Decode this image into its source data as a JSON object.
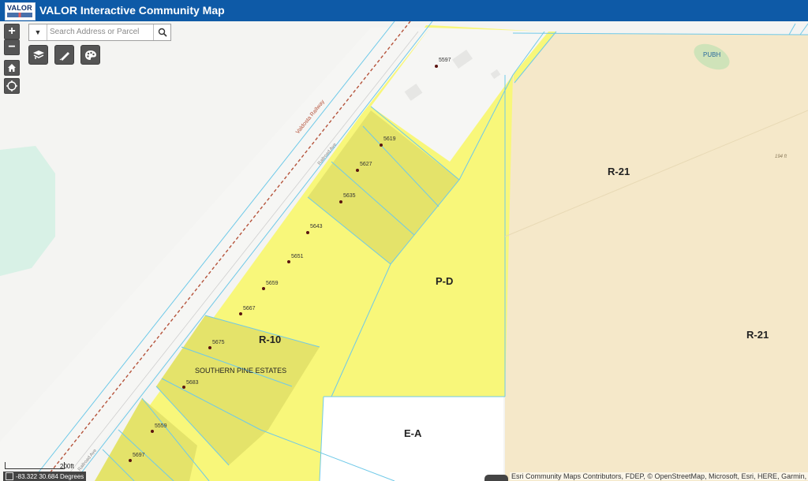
{
  "app": {
    "title": "VALOR Interactive Community Map",
    "logo_text": "VALOR"
  },
  "controls": {
    "zoom_in": "+",
    "zoom_out": "−"
  },
  "search": {
    "placeholder": "Search Address or Parcel"
  },
  "map": {
    "zones": [
      "R-21",
      "R-21",
      "P-D",
      "R-10",
      "E-A"
    ],
    "zone_codes": {
      "pubh": "PUBH"
    },
    "subdivision": "SOUTHERN PINE ESTATES",
    "roads": {
      "highway": "Valdosta Railway",
      "railroad_ave": "Railroad Ave",
      "lower_label": "Railroad Ave"
    },
    "addresses": [
      "5597",
      "5619",
      "5627",
      "5635",
      "5643",
      "5651",
      "5659",
      "5667",
      "5675",
      "5683",
      "5559",
      "5697"
    ],
    "elevation": "194 ft"
  },
  "scalebar": {
    "label": "200ft"
  },
  "coordinates": {
    "text": "-83.322 30.684 Degrees"
  },
  "attribution": {
    "text": "Esri Community Maps Contributors, FDEP, © OpenStreetMap, Microsoft, Esri, HERE, Garmin, Safe"
  },
  "colors": {
    "header": "#0e5aa7",
    "pd_zone": "#f8f77a",
    "r10_zone": "#e4e36a",
    "r21_zone": "#f5e8c9",
    "ea_zone": "#ffffff",
    "parcel_line": "#6fc9e8",
    "railroad": "#b5533b"
  }
}
